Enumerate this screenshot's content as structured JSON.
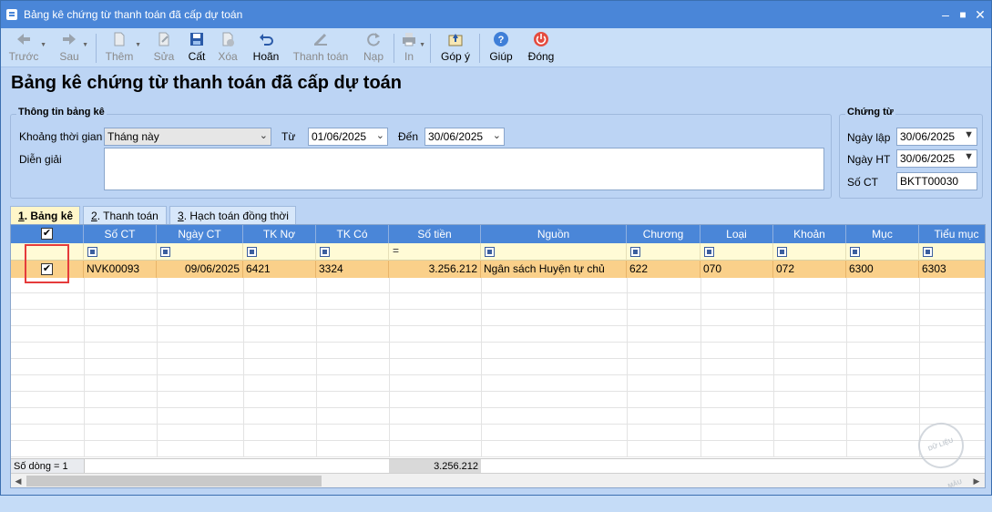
{
  "window": {
    "title": "Bảng kê chứng từ thanh toán đã cấp dự toán"
  },
  "toolbar": {
    "back": "Trước",
    "forward": "Sau",
    "add": "Thêm",
    "edit": "Sửa",
    "save": "Cất",
    "delete": "Xóa",
    "undo": "Hoãn",
    "pay": "Thanh toán",
    "load": "Nạp",
    "print": "In",
    "feedback": "Góp ý",
    "help": "Giúp",
    "close": "Đóng"
  },
  "page": {
    "title": "Bảng kê chứng từ thanh toán đã cấp dự toán"
  },
  "info_group": {
    "legend": "Thông tin bảng kê",
    "period_label": "Khoảng thời gian",
    "period_value": "Tháng này",
    "from_label": "Từ",
    "from_value": "01/06/2025",
    "to_label": "Đến",
    "to_value": "30/06/2025",
    "desc_label": "Diễn giải",
    "desc_value": ""
  },
  "voucher_group": {
    "legend": "Chứng từ",
    "date_label": "Ngày lập",
    "date_value": "30/06/2025",
    "post_date_label": "Ngày HT",
    "post_date_value": "30/06/2025",
    "no_label": "Số CT",
    "no_value": "BKTT00030"
  },
  "tabs": [
    {
      "num": "1",
      "label": ". Bảng kê"
    },
    {
      "num": "2",
      "label": ". Thanh toán"
    },
    {
      "num": "3",
      "label": ". Hạch toán đồng thời"
    }
  ],
  "grid": {
    "headers": [
      "Số CT",
      "Ngày CT",
      "TK Nợ",
      "TK Có",
      "Số tiền",
      "Nguồn",
      "Chương",
      "Loại",
      "Khoản",
      "Mục",
      "Tiểu mục"
    ],
    "rows": [
      {
        "checked": true,
        "cells": [
          "NVK00093",
          "09/06/2025",
          "6421",
          "3324",
          "3.256.212",
          "Ngân sách Huyện tự chủ",
          "622",
          "070",
          "072",
          "6300",
          "6303"
        ]
      }
    ],
    "footer_count": "Số dòng = 1",
    "footer_total": "3.256.212"
  },
  "stamp_text": "DỮ LIỆU MẪU"
}
